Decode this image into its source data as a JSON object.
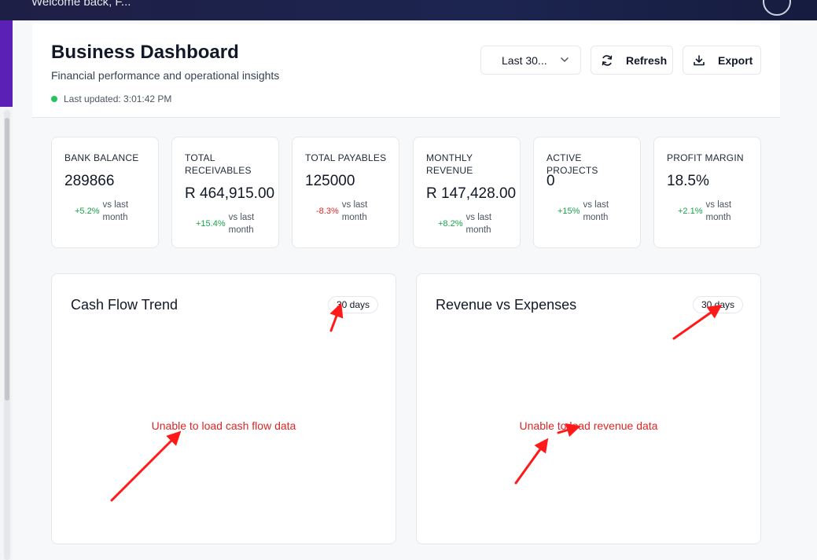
{
  "topbar": {
    "welcome_text": "Welcome back, F..."
  },
  "header": {
    "title": "Business Dashboard",
    "subtitle": "Financial performance and operational insights",
    "last_updated": "Last updated: 3:01:42 PM",
    "period_select": "Last 30...",
    "refresh_label": "Refresh",
    "export_label": "Export"
  },
  "kpis": [
    {
      "label": "BANK BALANCE",
      "value": "289866",
      "change": "+5.2%",
      "trend": "positive",
      "suffix": "vs last month"
    },
    {
      "label": "TOTAL RECEIVABLES",
      "value": "R 464,915.00",
      "change": "+15.4%",
      "trend": "positive",
      "suffix": "vs last month"
    },
    {
      "label": "TOTAL PAYABLES",
      "value": "125000",
      "change": "-8.3%",
      "trend": "negative",
      "suffix": "vs last month"
    },
    {
      "label": "MONTHLY REVENUE",
      "value": "R 147,428.00",
      "change": "+8.2%",
      "trend": "positive",
      "suffix": "vs last month"
    },
    {
      "label": "ACTIVE PROJECTS",
      "value": "0",
      "change": "+15%",
      "trend": "positive",
      "suffix": "vs last month"
    },
    {
      "label": "PROFIT MARGIN",
      "value": "18.5%",
      "change": "+2.1%",
      "trend": "positive",
      "suffix": "vs last month"
    }
  ],
  "panels": [
    {
      "title": "Cash Flow Trend",
      "badge": "30 days",
      "error": "Unable to load cash flow data"
    },
    {
      "title": "Revenue vs Expenses",
      "badge": "30 days",
      "error": "Unable to load revenue data"
    }
  ],
  "colors": {
    "positive": "#16a34a",
    "negative": "#dc2626",
    "status_dot": "#22c55e",
    "annotation_arrow": "#ff0000"
  },
  "icons": {
    "refresh": "refresh-icon",
    "export": "download-icon",
    "select": "chevron-down-icon"
  }
}
